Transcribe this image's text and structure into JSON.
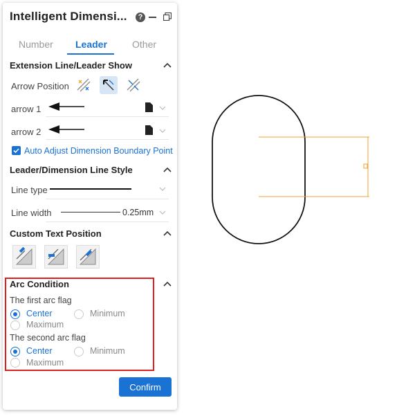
{
  "panel": {
    "title": "Intelligent Dimensi...",
    "help_icon": "question-circle-icon",
    "minimize_icon": "minimize-icon",
    "restore_icon": "restore-window-icon"
  },
  "tabs": [
    {
      "label": "Number",
      "active": false
    },
    {
      "label": "Leader",
      "active": true
    },
    {
      "label": "Other",
      "active": false
    }
  ],
  "extension": {
    "title": "Extension Line/Leader Show",
    "arrow_position_label": "Arrow Position",
    "arrow1_label": "arrow 1",
    "arrow2_label": "arrow 2",
    "auto_adjust_label": "Auto Adjust Dimension Boundary Point",
    "auto_adjust_checked": true
  },
  "leader_style": {
    "title": "Leader/Dimension Line Style",
    "line_type_label": "Line type",
    "line_width_label": "Line width",
    "line_width_value": "0.25mm"
  },
  "custom_text": {
    "title": "Custom Text Position"
  },
  "arc": {
    "title": "Arc Condition",
    "first_label": "The first arc flag",
    "second_label": "The second arc flag",
    "center": "Center",
    "minimum": "Minimum",
    "maximum": "Maximum",
    "first_selected": "Center",
    "second_selected": "Center"
  },
  "confirm_label": "Confirm",
  "colors": {
    "accent": "#1a73d4",
    "highlight_border": "#e02020",
    "dimension_line": "#f0a030"
  }
}
